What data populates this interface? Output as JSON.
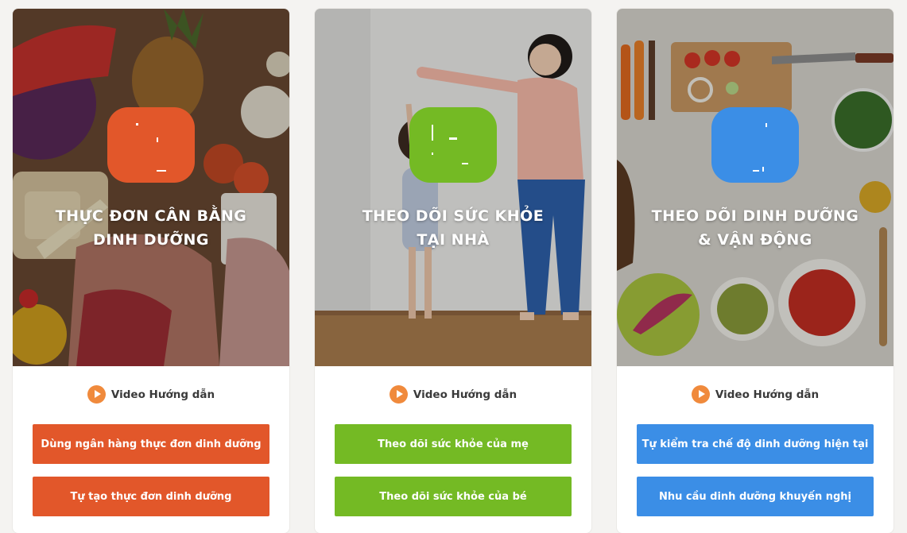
{
  "cards": [
    {
      "title_line1": "THỰC ĐƠN CÂN BẰNG",
      "title_line2": "DINH DƯỠNG",
      "video_label": "Video Hướng dẫn",
      "buttons": [
        "Dùng ngân hàng thực đơn dinh dưỡng",
        "Tự tạo thực đơn dinh dưỡng"
      ],
      "accent_color": "#e2572a",
      "icon": "menu-icon",
      "photo": "fresh-food-photo"
    },
    {
      "title_line1": "THEO DÕI SỨC KHỎE",
      "title_line2": "TẠI NHÀ",
      "video_label": "Video Hướng dẫn",
      "buttons": [
        "Theo dõi sức khỏe của mẹ",
        "Theo dõi sức khỏe của bé"
      ],
      "accent_color": "#74ba24",
      "icon": "health-icon",
      "photo": "mother-child-height-photo"
    },
    {
      "title_line1": "THEO DÕI DINH DƯỠNG",
      "title_line2": "& VẬN ĐỘNG",
      "video_label": "Video Hướng dẫn",
      "buttons": [
        "Tự kiểm tra chế độ dinh dưỡng hiện tại",
        "Nhu cầu dinh dưỡng khuyến nghị"
      ],
      "accent_color": "#3b8ee6",
      "icon": "nutrition-icon",
      "photo": "kitchen-table-photo"
    }
  ]
}
